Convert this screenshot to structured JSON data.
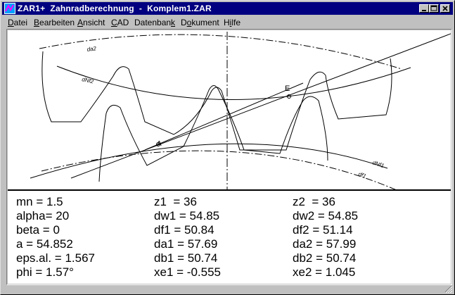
{
  "window": {
    "title": "ZAR1+  Zahnradberechnung  -  Komplem1.ZAR",
    "icon": "zar-app-icon",
    "controls": [
      "minimize-icon",
      "maximize-icon",
      "close-icon"
    ]
  },
  "menu": {
    "items": [
      {
        "label": "Datei",
        "accel": "D"
      },
      {
        "label": "Bearbeiten",
        "accel": "B"
      },
      {
        "label": "Ansicht",
        "accel": "A"
      },
      {
        "label": "CAD",
        "accel": "C"
      },
      {
        "label": "Datenbank",
        "accel": "k"
      },
      {
        "label": "Dokument",
        "accel": "o"
      },
      {
        "label": "Hilfe",
        "accel": "i"
      }
    ]
  },
  "drawing": {
    "labels": {
      "da2": "da2",
      "dNf2": "dNf2",
      "dNf1": "dNf1",
      "df1": "df1",
      "point_a": "A",
      "point_e": "E"
    }
  },
  "results": {
    "rows": [
      [
        "mn = 1.5",
        "z1  = 36",
        "z2  = 36"
      ],
      [
        "alpha= 20",
        "dw1 = 54.85",
        "dw2 = 54.85"
      ],
      [
        "beta = 0",
        "df1 = 50.84",
        "df2 = 51.14"
      ],
      [
        "a = 54.852",
        "da1 = 57.69",
        "da2 = 57.99"
      ],
      [
        "eps.al. = 1.567",
        "db1 = 50.74",
        "db2 = 50.74"
      ],
      [
        "phi = 1.57°",
        "xe1 = -0.555",
        "xe2 = 1.045"
      ]
    ]
  },
  "colors": {
    "titlebar": "#000080",
    "face": "#c0c0c0",
    "canvas": "#ffffff"
  }
}
